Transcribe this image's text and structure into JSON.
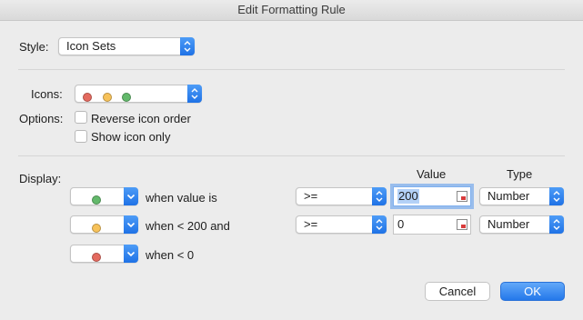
{
  "window": {
    "title": "Edit Formatting Rule"
  },
  "style": {
    "label": "Style:",
    "value": "Icon Sets"
  },
  "icons": {
    "label": "Icons:",
    "set_colors": [
      "#e46a5f",
      "#f7c25a",
      "#63b96b"
    ]
  },
  "options": {
    "label": "Options:",
    "reverse_label": "Reverse icon order",
    "reverse_checked": false,
    "show_only_label": "Show icon only",
    "show_only_checked": false
  },
  "display": {
    "label": "Display:",
    "value_header": "Value",
    "type_header": "Type",
    "rows": [
      {
        "icon_color": "#63b96b",
        "condition": "when value is",
        "operator": ">=",
        "value": "200",
        "type": "Number"
      },
      {
        "icon_color": "#f7c25a",
        "condition": "when < 200 and",
        "operator": ">=",
        "value": "0",
        "type": "Number"
      },
      {
        "icon_color": "#e46a5f",
        "condition": "when < 0"
      }
    ]
  },
  "buttons": {
    "cancel": "Cancel",
    "ok": "OK"
  },
  "colors": {
    "accent": "#2478ea",
    "dialog_bg": "#ececec"
  }
}
